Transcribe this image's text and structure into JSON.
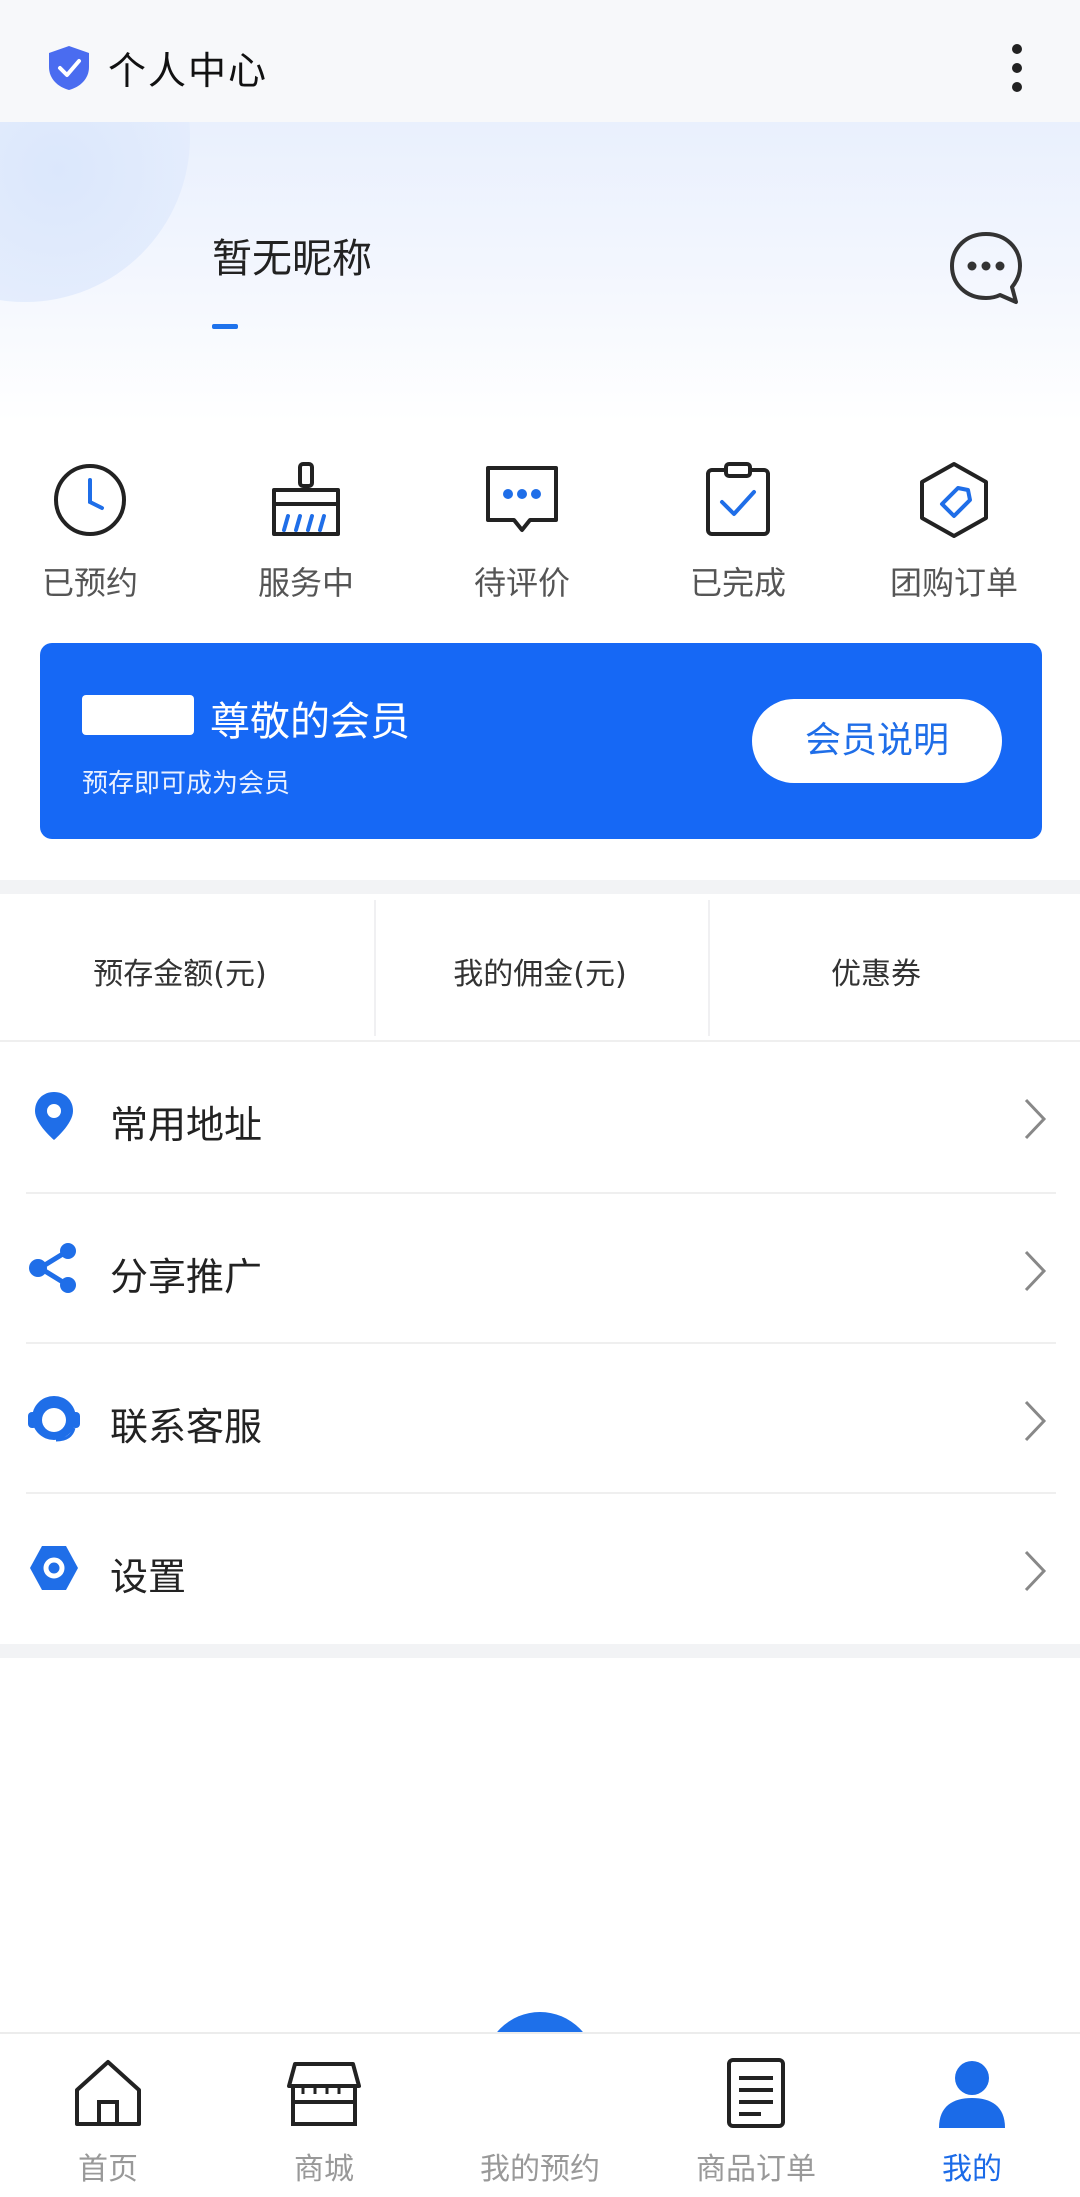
{
  "app": {
    "title": "个人中心"
  },
  "profile": {
    "nickname": "暂无昵称"
  },
  "quick_actions": [
    {
      "label": "已预约",
      "icon": "clock-icon"
    },
    {
      "label": "服务中",
      "icon": "broom-icon"
    },
    {
      "label": "待评价",
      "icon": "comment-dots-icon"
    },
    {
      "label": "已完成",
      "icon": "clipboard-check-icon"
    },
    {
      "label": "团购订单",
      "icon": "tag-icon"
    }
  ],
  "member": {
    "title": "尊敬的会员",
    "subtitle": "预存即可成为会员",
    "button": "会员说明"
  },
  "stats": [
    {
      "label": "预存金额(元)"
    },
    {
      "label": "我的佣金(元)"
    },
    {
      "label": "优惠券"
    }
  ],
  "menu": [
    {
      "label": "常用地址",
      "icon": "location-pin-icon"
    },
    {
      "label": "分享推广",
      "icon": "share-icon"
    },
    {
      "label": "联系客服",
      "icon": "headset-icon"
    },
    {
      "label": "设置",
      "icon": "settings-hex-icon"
    }
  ],
  "bottom_nav": [
    {
      "label": "首页",
      "icon": "home-icon",
      "active": false
    },
    {
      "label": "商城",
      "icon": "store-icon",
      "active": false
    },
    {
      "label": "我的预约",
      "icon": "booking-icon",
      "active": false
    },
    {
      "label": "商品订单",
      "icon": "order-list-icon",
      "active": false
    },
    {
      "label": "我的",
      "icon": "user-icon",
      "active": true
    }
  ],
  "colors": {
    "accent": "#1668f5",
    "active_tab": "#1b6be8",
    "inactive_tab": "#999999"
  }
}
